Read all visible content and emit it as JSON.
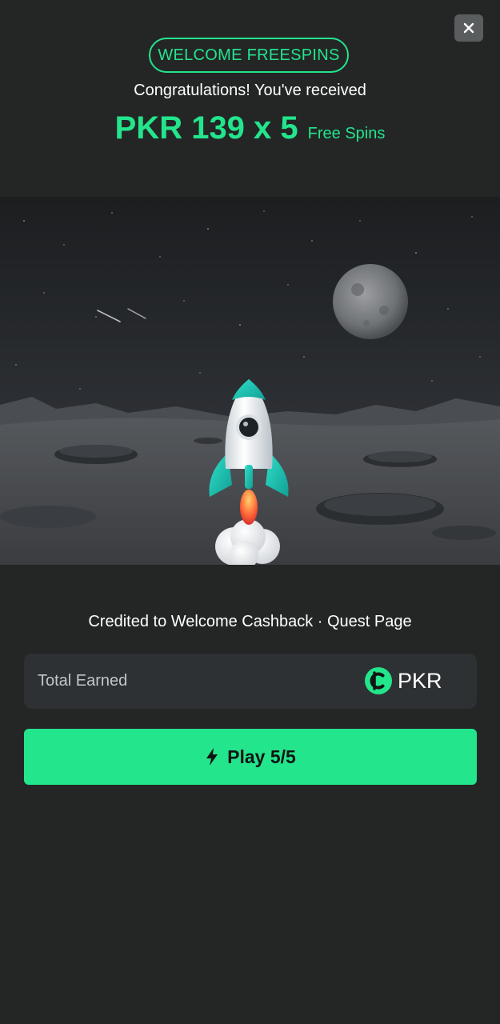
{
  "header": {
    "badge_label": "WELCOME FREESPINS",
    "congrats_text": "Congratulations! You've received",
    "amount": "PKR 139 x 5",
    "amount_suffix": "Free Spins"
  },
  "hero": {
    "illustration": "rocket-over-moon-surface"
  },
  "credited_text": "Credited to Welcome Cashback · Quest Page",
  "earned": {
    "label": "Total Earned",
    "currency": "PKR",
    "currency_icon": "coin-icon"
  },
  "play_button": {
    "label": "Play 5/5",
    "icon": "bolt-icon"
  },
  "colors": {
    "accent": "#23e58c",
    "background": "#242626",
    "card": "#2e3133"
  }
}
